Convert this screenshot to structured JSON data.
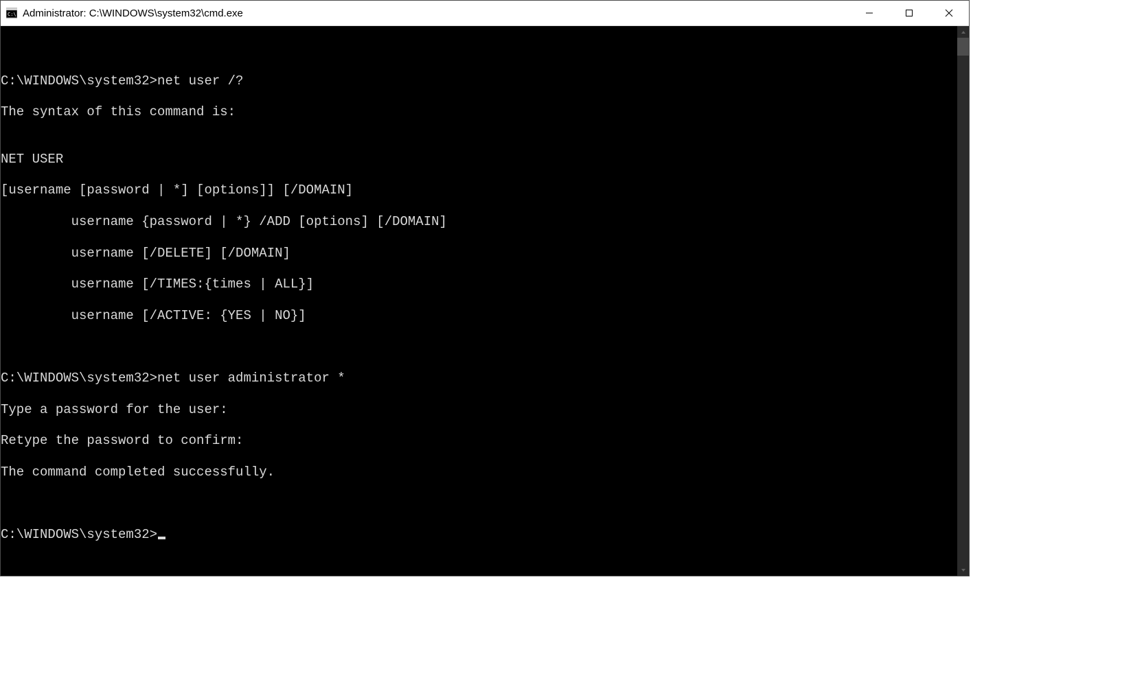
{
  "window": {
    "title": "Administrator: C:\\WINDOWS\\system32\\cmd.exe"
  },
  "terminal": {
    "lines": [
      "",
      "C:\\WINDOWS\\system32>net user /?",
      "The syntax of this command is:",
      "",
      "NET USER",
      "[username [password | *] [options]] [/DOMAIN]",
      "         username {password | *} /ADD [options] [/DOMAIN]",
      "         username [/DELETE] [/DOMAIN]",
      "         username [/TIMES:{times | ALL}]",
      "         username [/ACTIVE: {YES | NO}]",
      "",
      "",
      "C:\\WINDOWS\\system32>net user administrator *",
      "Type a password for the user:",
      "Retype the password to confirm:",
      "The command completed successfully.",
      "",
      ""
    ],
    "prompt": "C:\\WINDOWS\\system32>"
  }
}
